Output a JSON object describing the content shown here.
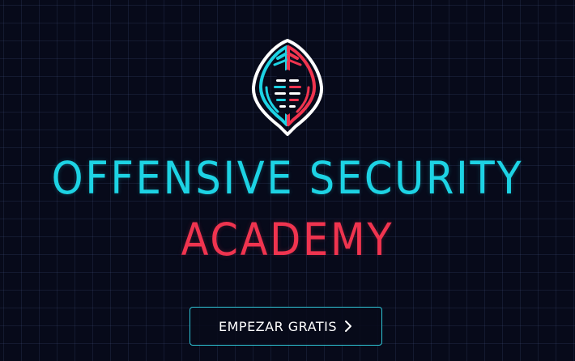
{
  "hero": {
    "title_line1": "OFFENSIVE SECURITY",
    "title_line2": "ACADEMY",
    "cta_label": "EMPEZAR GRATIS",
    "cta_icon": "chevron-right-icon"
  },
  "logo": {
    "icon": "hooded-hacker-icon"
  },
  "colors": {
    "background": "#070a1a",
    "accent_cyan": "#1dd3e4",
    "accent_red": "#f0344f",
    "button_border": "#2fc7d8",
    "button_text": "#ffffff"
  }
}
